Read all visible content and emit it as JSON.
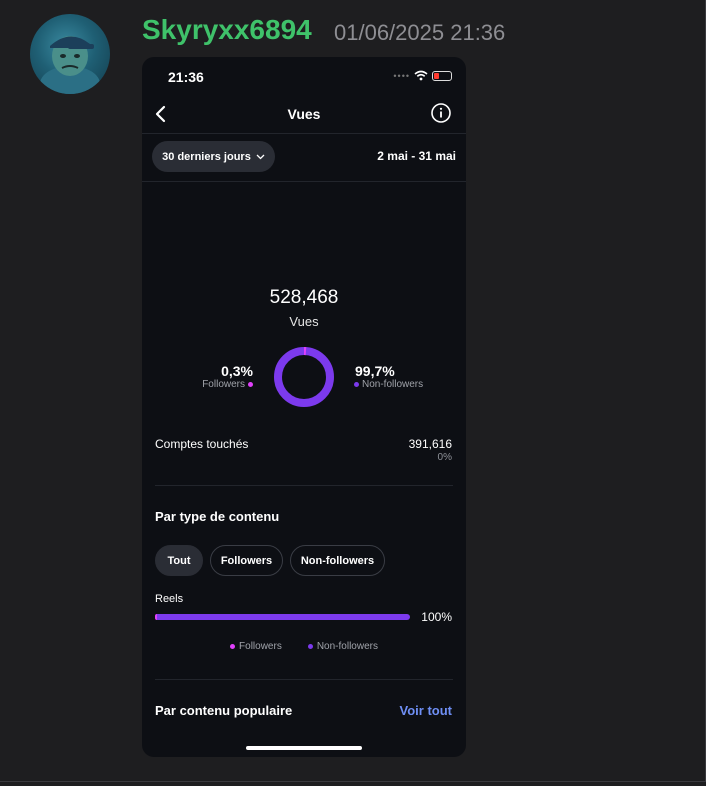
{
  "message": {
    "author": "Skyryxx6894",
    "timestamp": "01/06/2025 21:36"
  },
  "phone": {
    "status_time": "21:36",
    "nav_title": "Vues",
    "range_button": "30 derniers jours",
    "date_range": "2 mai - 31 mai",
    "total_views": "528,468",
    "views_label": "Vues",
    "followers_pct": "0,3%",
    "followers_label": "Followers",
    "nonfollowers_pct": "99,7%",
    "nonfollowers_label": "Non-followers",
    "donut_followers_fraction": 0.003,
    "reach_label": "Comptes touchés",
    "reach_value": "391,616",
    "reach_pct": "0%",
    "section_type": "Par type de contenu",
    "chips": [
      "Tout",
      "Followers",
      "Non-followers"
    ],
    "reels_label": "Reels",
    "reels_pct": "100%",
    "reels_fraction": 1.0,
    "legend_followers": "Followers",
    "legend_nonfollowers": "Non-followers",
    "section_popular": "Par contenu populaire",
    "see_all": "Voir tout"
  },
  "colors": {
    "author": "#3fc26a",
    "followers": "#e040fb",
    "nonfollowers": "#7c3aed",
    "link": "#6f8ff5"
  }
}
